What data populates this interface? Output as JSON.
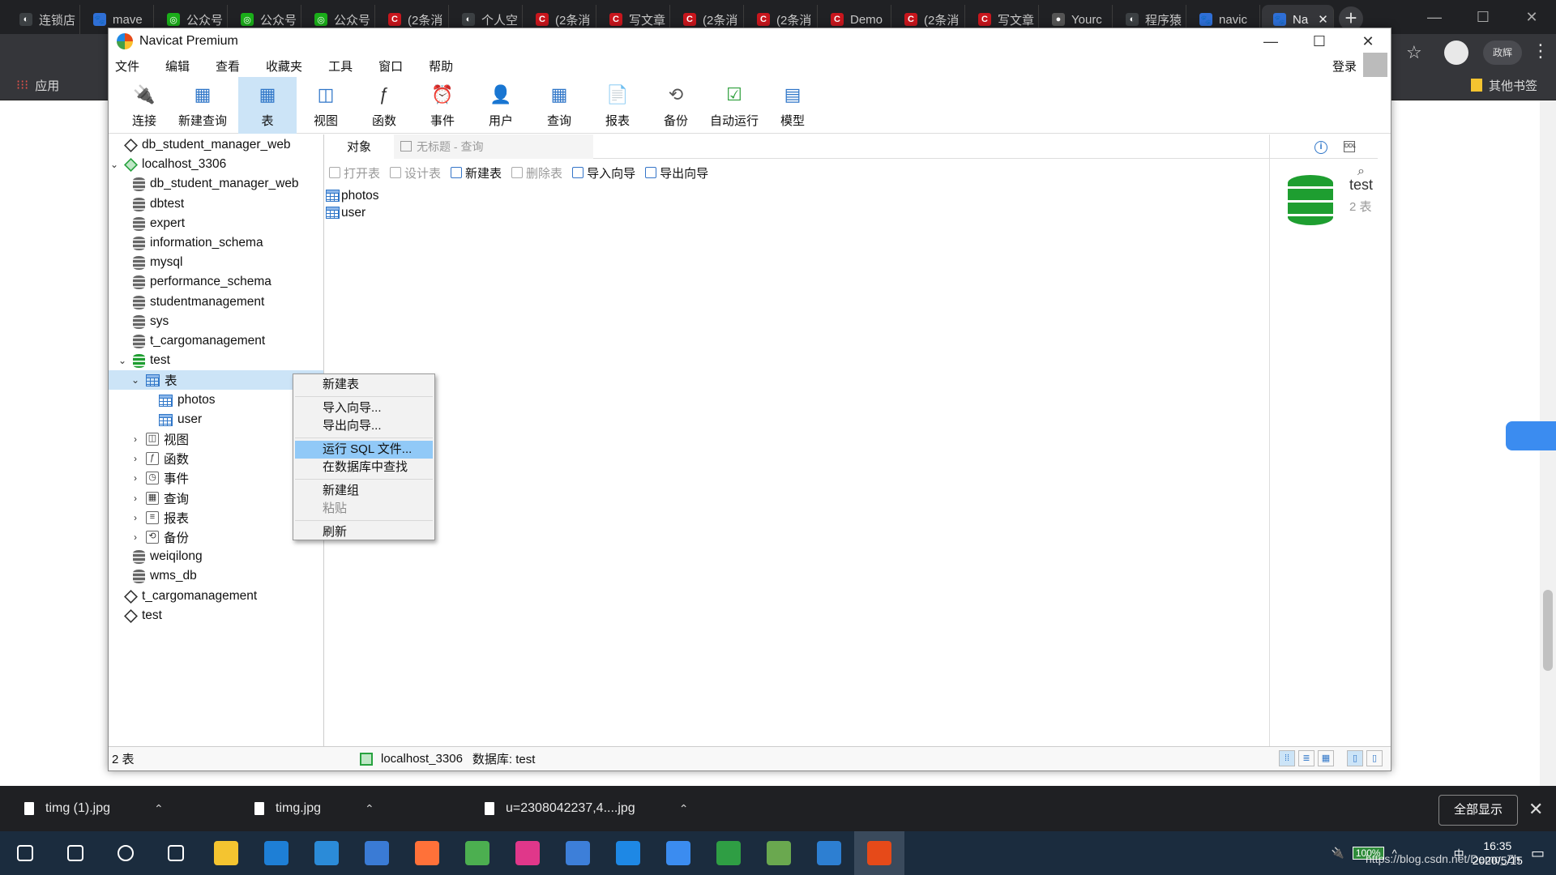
{
  "chrome": {
    "tabs": [
      {
        "label": "连锁店",
        "color": "#3c4043",
        "glyph": "◐"
      },
      {
        "label": "mave",
        "color": "#2f6fd6",
        "glyph": "🐾"
      },
      {
        "label": "公众号",
        "color": "#1aad19",
        "glyph": "◎"
      },
      {
        "label": "公众号",
        "color": "#1aad19",
        "glyph": "◎"
      },
      {
        "label": "公众号",
        "color": "#1aad19",
        "glyph": "◎"
      },
      {
        "label": "(2条消",
        "color": "#c8161d",
        "glyph": "C"
      },
      {
        "label": "个人空",
        "color": "#3c4043",
        "glyph": "◐"
      },
      {
        "label": "(2条消",
        "color": "#c8161d",
        "glyph": "C"
      },
      {
        "label": "写文章",
        "color": "#c8161d",
        "glyph": "C"
      },
      {
        "label": "(2条消",
        "color": "#c8161d",
        "glyph": "C"
      },
      {
        "label": "(2条消",
        "color": "#c8161d",
        "glyph": "C"
      },
      {
        "label": "Demo",
        "color": "#c8161d",
        "glyph": "C"
      },
      {
        "label": "(2条消",
        "color": "#c8161d",
        "glyph": "C"
      },
      {
        "label": "写文章",
        "color": "#c8161d",
        "glyph": "C"
      },
      {
        "label": "Yourc",
        "color": "#555555",
        "glyph": "●"
      },
      {
        "label": "程序猿",
        "color": "#3c4043",
        "glyph": "◐"
      },
      {
        "label": "navic",
        "color": "#2f6fd6",
        "glyph": "🐾"
      },
      {
        "label": "Na",
        "color": "#2f6fd6",
        "glyph": "🐾",
        "active": true
      }
    ],
    "new_tab": "+",
    "win_controls": [
      "—",
      "☐",
      "✕"
    ],
    "bookmarks_apps": "应用",
    "bookmarks_other": "其他书签",
    "profile_label": "政辉"
  },
  "navicat": {
    "title": "Navicat Premium",
    "win_controls": [
      "—",
      "☐",
      "✕"
    ],
    "menu": [
      "文件",
      "编辑",
      "查看",
      "收藏夹",
      "工具",
      "窗口",
      "帮助"
    ],
    "login": "登录",
    "toolbar": [
      {
        "label": "连接",
        "icon": "plug-icon",
        "glyph": "🔌"
      },
      {
        "label": "新建查询",
        "icon": "new-query-icon",
        "glyph": "▦"
      },
      {
        "label": "表",
        "icon": "table-icon",
        "glyph": "▦",
        "selected": true
      },
      {
        "label": "视图",
        "icon": "view-icon",
        "glyph": "◫"
      },
      {
        "label": "函数",
        "icon": "function-icon",
        "glyph": "ƒ"
      },
      {
        "label": "事件",
        "icon": "event-icon",
        "glyph": "⏰"
      },
      {
        "label": "用户",
        "icon": "user-icon",
        "glyph": "👤"
      },
      {
        "label": "查询",
        "icon": "query-icon",
        "glyph": "▦"
      },
      {
        "label": "报表",
        "icon": "report-icon",
        "glyph": "📄"
      },
      {
        "label": "备份",
        "icon": "backup-icon",
        "glyph": "⟲"
      },
      {
        "label": "自动运行",
        "icon": "auto-run-icon",
        "glyph": "☑"
      },
      {
        "label": "模型",
        "icon": "model-icon",
        "glyph": "▤"
      }
    ],
    "tree": [
      {
        "label": "db_student_manager_web",
        "level": 0,
        "icon": "conn"
      },
      {
        "label": "localhost_3306",
        "level": 0,
        "icon": "conn-on",
        "arrow": "⌄"
      },
      {
        "label": "db_student_manager_web",
        "level": 1,
        "icon": "db"
      },
      {
        "label": "dbtest",
        "level": 1,
        "icon": "db"
      },
      {
        "label": "expert",
        "level": 1,
        "icon": "db"
      },
      {
        "label": "information_schema",
        "level": 1,
        "icon": "db"
      },
      {
        "label": "mysql",
        "level": 1,
        "icon": "db"
      },
      {
        "label": "performance_schema",
        "level": 1,
        "icon": "db"
      },
      {
        "label": "studentmanagement",
        "level": 1,
        "icon": "db"
      },
      {
        "label": "sys",
        "level": 1,
        "icon": "db"
      },
      {
        "label": "t_cargomanagement",
        "level": 1,
        "icon": "db"
      },
      {
        "label": "test",
        "level": 1,
        "icon": "db-on",
        "arrow": "⌄"
      },
      {
        "label": "表",
        "level": 2,
        "icon": "tbl",
        "arrow": "⌄",
        "highlight": true
      },
      {
        "label": "photos",
        "level": 3,
        "icon": "tbl"
      },
      {
        "label": "user",
        "level": 3,
        "icon": "tbl"
      },
      {
        "label": "视图",
        "level": 2,
        "icon": "gen",
        "arrow": "›",
        "glyph": "◫"
      },
      {
        "label": "函数",
        "level": 2,
        "icon": "gen",
        "arrow": "›",
        "glyph": "ƒ"
      },
      {
        "label": "事件",
        "level": 2,
        "icon": "gen",
        "arrow": "›",
        "glyph": "◷"
      },
      {
        "label": "查询",
        "level": 2,
        "icon": "gen",
        "arrow": "›",
        "glyph": "▦"
      },
      {
        "label": "报表",
        "level": 2,
        "icon": "gen",
        "arrow": "›",
        "glyph": "≡"
      },
      {
        "label": "备份",
        "level": 2,
        "icon": "gen",
        "arrow": "›",
        "glyph": "⟲"
      },
      {
        "label": "weiqilong",
        "level": 1,
        "icon": "db"
      },
      {
        "label": "wms_db",
        "level": 1,
        "icon": "db"
      },
      {
        "label": "t_cargomanagement",
        "level": 0,
        "icon": "conn"
      },
      {
        "label": "test",
        "level": 0,
        "icon": "conn"
      }
    ],
    "tabs": {
      "objects": "对象",
      "query": "无标题 - 查询"
    },
    "object_toolbar": [
      {
        "label": "打开表",
        "disabled": true
      },
      {
        "label": "设计表",
        "disabled": true
      },
      {
        "label": "新建表",
        "disabled": false
      },
      {
        "label": "删除表",
        "disabled": true
      },
      {
        "label": "导入向导",
        "disabled": false
      },
      {
        "label": "导出向导",
        "disabled": false
      }
    ],
    "objects": [
      "photos",
      "user"
    ],
    "info": {
      "name": "test",
      "count": "2 表"
    },
    "status": {
      "left": "2 表",
      "connection": "localhost_3306",
      "database": "数据库: test"
    },
    "context_menu": [
      [
        {
          "label": "新建表"
        }
      ],
      [
        {
          "label": "导入向导..."
        },
        {
          "label": "导出向导..."
        }
      ],
      [
        {
          "label": "运行 SQL 文件...",
          "hover": true
        },
        {
          "label": "在数据库中查找"
        }
      ],
      [
        {
          "label": "新建组"
        },
        {
          "label": "粘贴",
          "disabled": true
        }
      ],
      [
        {
          "label": "刷新"
        }
      ]
    ]
  },
  "downloads": {
    "items": [
      "timg (1).jpg",
      "timg.jpg",
      "u=2308042237,4....jpg"
    ],
    "show_all": "全部显示"
  },
  "taskbar": {
    "apps": [
      {
        "name": "start-icon",
        "color": "#ffffff"
      },
      {
        "name": "search-icon",
        "color": "#ffffff"
      },
      {
        "name": "cortana-icon",
        "color": "#ffffff"
      },
      {
        "name": "task-view-icon",
        "color": "#ffffff"
      },
      {
        "name": "file-explorer-icon",
        "color": "#f4c430"
      },
      {
        "name": "mail-icon",
        "color": "#1e7fd6"
      },
      {
        "name": "news-icon",
        "color": "#2b8bd8"
      },
      {
        "name": "store-icon",
        "color": "#3a7bd5"
      },
      {
        "name": "firefox-icon",
        "color": "#ff7139"
      },
      {
        "name": "chrome-icon",
        "color": "#4caf50"
      },
      {
        "name": "intellij-icon",
        "color": "#e0378a"
      },
      {
        "name": "remote-desktop-icon",
        "color": "#3d7fd9"
      },
      {
        "name": "phone-icon",
        "color": "#1e88e5"
      },
      {
        "name": "baidu-netdisk-icon",
        "color": "#3b8cf0"
      },
      {
        "name": "git-icon",
        "color": "#2f9e44"
      },
      {
        "name": "notepad-icon",
        "color": "#6aa84f"
      },
      {
        "name": "photos-icon",
        "color": "#2d7fd2"
      },
      {
        "name": "navicat-icon",
        "color": "#e64a19",
        "active": true
      }
    ],
    "battery": "100%",
    "ime": "中",
    "time": "16:35",
    "date": "2020/5/15",
    "watermark": "https://blog.csdn.net/Demo_Zh"
  }
}
